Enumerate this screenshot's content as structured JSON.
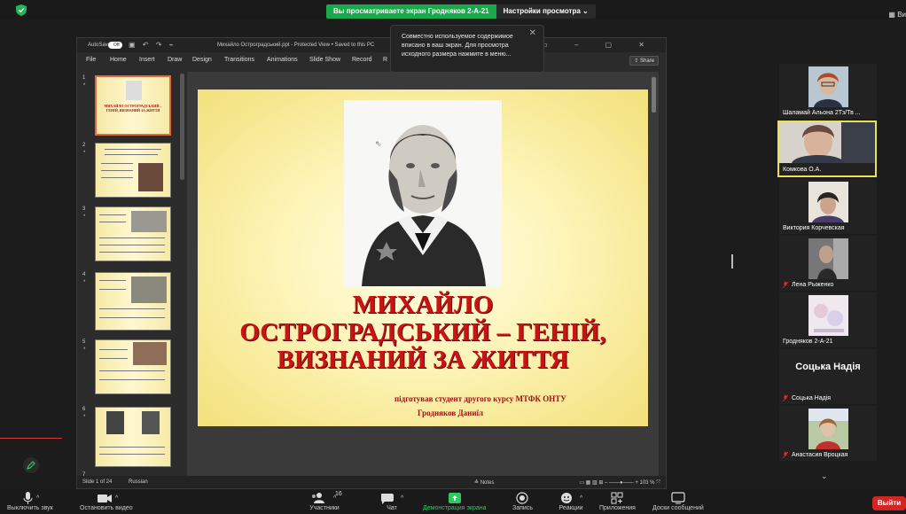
{
  "zoom": {
    "share_message": "Вы просматриваете экран Гродняков 2-А-21",
    "view_options": "Настройки просмотра",
    "view_button": "Ви",
    "tooltip": "Совместно используемое содержимое вписано в ваш экран. Для просмотра исходного размера нажмите в меню...",
    "toolbar": {
      "mute": "Выключить звук",
      "video": "Остановить видео",
      "participants": "Участники",
      "participants_count": "16",
      "chat": "Чат",
      "share": "Демонстрация экрана",
      "record": "Запись",
      "reactions": "Реакции",
      "apps": "Приложения",
      "whiteboards": "Доски сообщений",
      "leave": "Выйти"
    },
    "participants": [
      {
        "name": "Шаламай Альона 2Тз/Тв ...",
        "muted": false,
        "speaking": false
      },
      {
        "name": "Комкова О.А.",
        "muted": false,
        "speaking": true
      },
      {
        "name": "Виктория Корчевская",
        "muted": false,
        "speaking": false
      },
      {
        "name": "Лена Рыженко",
        "muted": true,
        "speaking": false
      },
      {
        "name": "Гродняков 2-А-21",
        "muted": false,
        "speaking": false
      },
      {
        "name": "Соцька Надія",
        "display": "Соцька Надія",
        "muted": true,
        "speaking": false
      },
      {
        "name": "Анастасия Вроцкая",
        "muted": true,
        "speaking": false
      }
    ]
  },
  "ppt": {
    "autosave": "AutoSave",
    "autosave_state": "Off",
    "filename": "Михайло Остроградський.ppt - Protected View • Saved to this PC",
    "menu": [
      "File",
      "Home",
      "Insert",
      "Draw",
      "Design",
      "Transitions",
      "Animations",
      "Slide Show",
      "Record",
      "R"
    ],
    "share": "Share",
    "status_slide": "Slide 1 of 24",
    "status_lang": "Russian",
    "notes": "Notes",
    "zoom": "103 %",
    "thumb_numbers": [
      "1",
      "2",
      "3",
      "4",
      "5",
      "6",
      "7"
    ],
    "thumb1_text": "МИХАЙЛО ОСТРОГРАДСЬКИЙ – ГЕНІЙ, ВИЗНАНИЙ ЗА ЖИТТЯ",
    "slide": {
      "title_line1": "МИХАЙЛО",
      "title_line2": "ОСТРОГРАДСЬКИЙ – ГЕНІЙ,",
      "title_line3": "ВИЗНАНИЙ ЗА ЖИТТЯ",
      "subtitle": "підготував студент другого курсу МТФК ОНТУ",
      "author": "Гродняков Даниїл"
    }
  }
}
